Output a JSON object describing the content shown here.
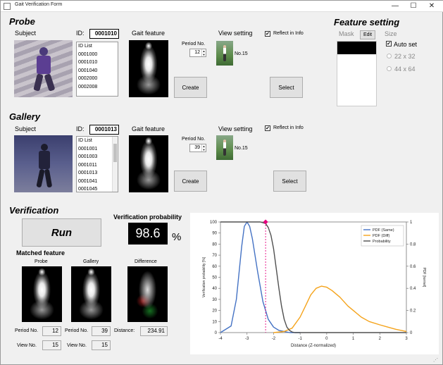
{
  "window": {
    "title": "Gait Verification Form",
    "minimize": "—",
    "maximize": "☐",
    "close": "✕"
  },
  "probe": {
    "section_title": "Probe",
    "subject_label": "Subject",
    "id_label": "ID:",
    "id_value": "0001010",
    "id_list_header": "ID List",
    "id_list": [
      "0001000",
      "0001010",
      "0001040",
      "0002000",
      "0002008"
    ],
    "gait_feature_label": "Gait feature",
    "period_label": "Period No.",
    "period_value": "12",
    "view_setting_label": "View setting",
    "reflect_label": "Reflect in Info",
    "reflect_checked": true,
    "view_no_label": "No.15",
    "create_label": "Create",
    "select_label": "Select"
  },
  "gallery": {
    "section_title": "Gallery",
    "subject_label": "Subject",
    "id_label": "ID:",
    "id_value": "0001013",
    "id_list_header": "ID List",
    "id_list": [
      "0001001",
      "0001003",
      "0001011",
      "0001013",
      "0001041",
      "0001045"
    ],
    "gait_feature_label": "Gait feature",
    "period_label": "Period No.",
    "period_value": "39",
    "view_setting_label": "View setting",
    "reflect_label": "Reflect in Info",
    "reflect_checked": true,
    "view_no_label": "No.15",
    "create_label": "Create",
    "select_label": "Select"
  },
  "feature_setting": {
    "section_title": "Feature setting",
    "mask_label": "Mask",
    "edit_label": "Edit",
    "size_label": "Size",
    "auto_set_label": "Auto set",
    "auto_set_checked": true,
    "size_options": [
      "22 x 32",
      "44 x 64"
    ]
  },
  "verification": {
    "section_title": "Verification",
    "run_label": "Run",
    "probability_label": "Verification probability",
    "probability_value": "98.6",
    "percent_sign": "%",
    "matched_feature_label": "Matched feature",
    "probe_col": "Probe",
    "gallery_col": "Gallery",
    "difference_col": "Difference",
    "period_no_label": "Period No.",
    "view_no_label": "View No.",
    "probe_period": "12",
    "probe_view": "15",
    "gallery_period": "39",
    "gallery_view": "15",
    "distance_label": "Distance:",
    "distance_value": "234.91"
  },
  "colors": {
    "pdf_same": "#4472c4",
    "pdf_diff": "#f5a31a",
    "probability": "#505050",
    "marker": "#e6007e"
  },
  "chart_data": {
    "type": "line",
    "xlabel": "Distance (Z-normalized)",
    "ylabel": "Verification probability [%]",
    "y2label": "PDF [kernel]",
    "xlim": [
      -4,
      3
    ],
    "ylim": [
      0,
      100
    ],
    "y2lim": [
      0,
      1
    ],
    "x_ticks": [
      -4,
      -3,
      -2,
      -1,
      0,
      1,
      2,
      3
    ],
    "y_ticks": [
      0,
      10,
      20,
      30,
      40,
      50,
      60,
      70,
      80,
      90,
      100
    ],
    "y2_ticks": [
      0,
      0.2,
      0.4,
      0.6,
      0.8,
      1
    ],
    "marker_x": -2.3,
    "marker_y": 100,
    "legend": [
      "PDF (Same)",
      "PDF (Diff)",
      "Probability"
    ],
    "legend_position": "top-right",
    "series": [
      {
        "name": "PDF (Same)",
        "axis": "right",
        "x": [
          -4,
          -3.6,
          -3.4,
          -3.2,
          -3.1,
          -3.0,
          -2.9,
          -2.8,
          -2.6,
          -2.4,
          -2.2,
          -2.0,
          -1.8,
          -1.6,
          -1.4,
          -1.2,
          -1.0
        ],
        "values": [
          0.0,
          0.06,
          0.3,
          0.78,
          0.96,
          1.0,
          0.96,
          0.85,
          0.55,
          0.28,
          0.12,
          0.05,
          0.02,
          0.01,
          0.0,
          0.0,
          0.0
        ]
      },
      {
        "name": "PDF (Diff)",
        "axis": "right",
        "x": [
          -2.0,
          -1.6,
          -1.3,
          -1.0,
          -0.8,
          -0.6,
          -0.4,
          -0.2,
          0.0,
          0.2,
          0.5,
          0.8,
          1.0,
          1.3,
          1.6,
          2.0,
          2.3,
          2.6,
          3.0
        ],
        "values": [
          0.0,
          0.01,
          0.04,
          0.14,
          0.24,
          0.34,
          0.4,
          0.42,
          0.41,
          0.38,
          0.32,
          0.24,
          0.2,
          0.14,
          0.1,
          0.07,
          0.05,
          0.03,
          0.01
        ]
      },
      {
        "name": "Probability",
        "axis": "left",
        "x": [
          -4,
          -2.7,
          -2.5,
          -2.3,
          -2.2,
          -2.1,
          -2.0,
          -1.9,
          -1.8,
          -1.7,
          -1.6,
          -1.5,
          -1.4,
          -1.3,
          -1.2,
          3
        ],
        "values": [
          100,
          100,
          100,
          98.6,
          95,
          88,
          76,
          58,
          40,
          24,
          12,
          5,
          2,
          0.5,
          0,
          0
        ]
      }
    ]
  }
}
